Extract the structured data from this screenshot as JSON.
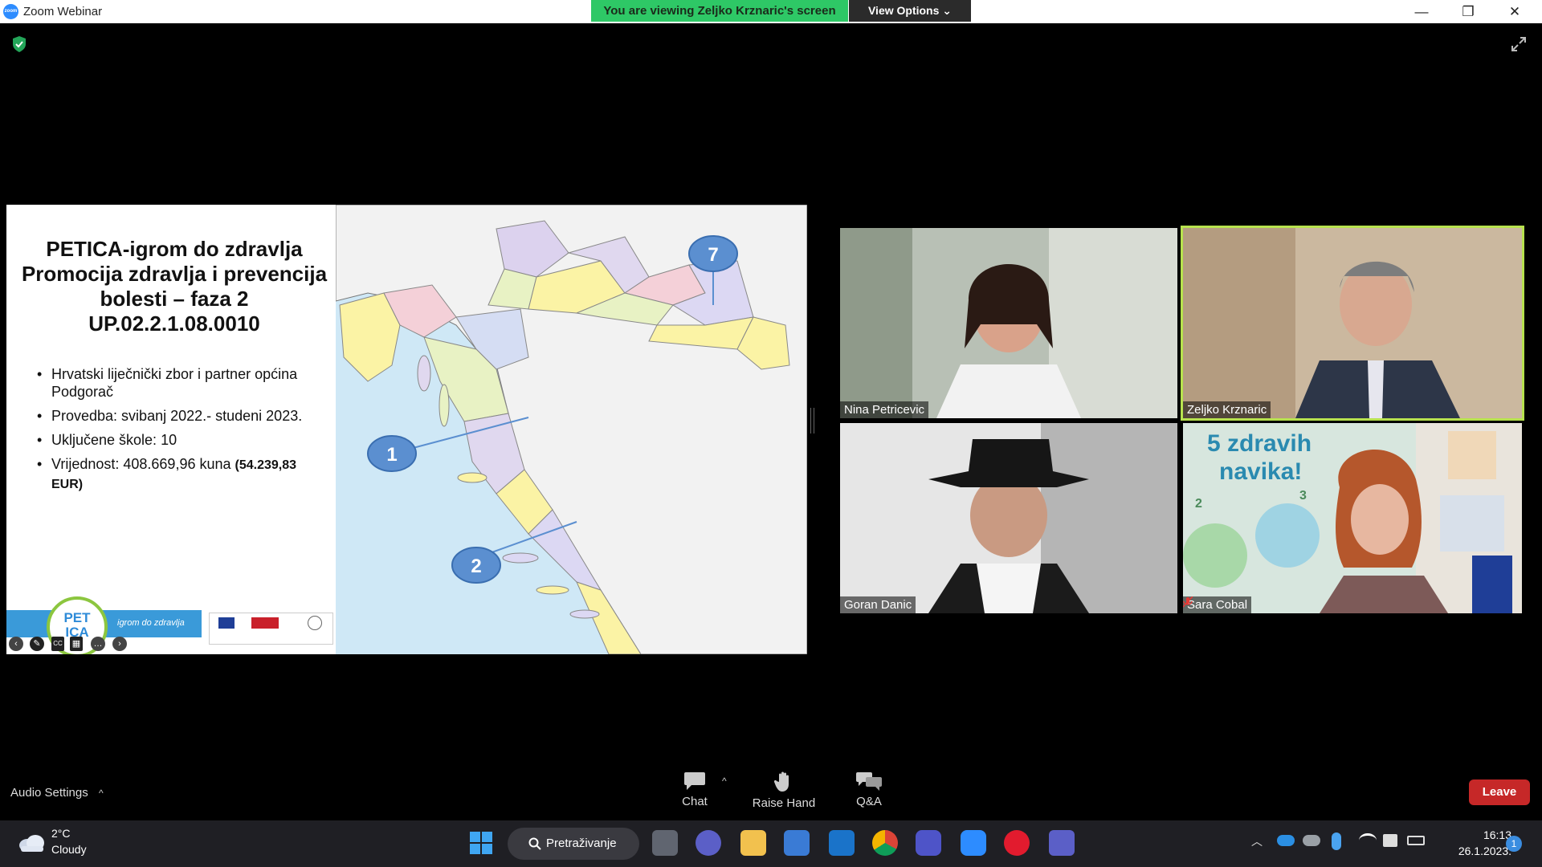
{
  "window": {
    "title": "Zoom Webinar",
    "app_icon_text": "zoom",
    "viewing_banner": "You are viewing Zeljko Krznaric's screen",
    "view_options": "View Options ⌄",
    "minimize": "—",
    "restore": "❐",
    "close": "✕"
  },
  "slide": {
    "title_lines": [
      "PETICA-igrom do zdravlja",
      "Promocija zdravlja i prevencija",
      "bolesti – faza 2",
      "UP.02.2.1.08.0010"
    ],
    "bullets": [
      {
        "text": "Hrvatski liječnički zbor i partner općina Podgorač"
      },
      {
        "text": "Provedba: svibanj 2022.- studeni 2023."
      },
      {
        "text": "Uključene škole: 10"
      },
      {
        "text": "Vrijednost: 408.669,96 kuna",
        "bold": "(54.239,83 EUR)"
      }
    ],
    "logo_top": "PET",
    "logo_bottom": "ICA",
    "logo_tagline": "igrom do zdravlja",
    "map_markers": [
      "1",
      "2",
      "7"
    ],
    "controls": [
      "‹",
      "✎",
      "CC",
      "▦",
      "…",
      "›"
    ]
  },
  "participants": [
    {
      "name": "Nina Petricevic",
      "muted": false,
      "speaking": false
    },
    {
      "name": "Zeljko Krznaric",
      "muted": false,
      "speaking": true
    },
    {
      "name": "Goran Danic",
      "muted": false,
      "speaking": false
    },
    {
      "name": "Sara Cobal",
      "muted": true,
      "speaking": false
    }
  ],
  "backdrop_text": {
    "sara_sign_line1": "5 zdravih",
    "sara_sign_line2": "navika!",
    "sara_sign_num_a": "2",
    "sara_sign_num_b": "3"
  },
  "toolbar": {
    "audio_settings": "Audio Settings",
    "audio_caret": "^",
    "chat": "Chat",
    "chat_caret": "^",
    "raise_hand": "Raise Hand",
    "qa": "Q&A",
    "leave": "Leave"
  },
  "taskbar": {
    "weather_temp": "2°C",
    "weather_desc": "Cloudy",
    "search": "Pretraživanje",
    "time": "16:13",
    "date": "26.1.2023.",
    "notifications": "1"
  },
  "colors": {
    "banner_green": "#2ec866",
    "speaker_border": "#b7e24e",
    "leave_red": "#c62828",
    "map_sea": "#cfe8f6",
    "marker_blue": "#5b8fd0"
  }
}
